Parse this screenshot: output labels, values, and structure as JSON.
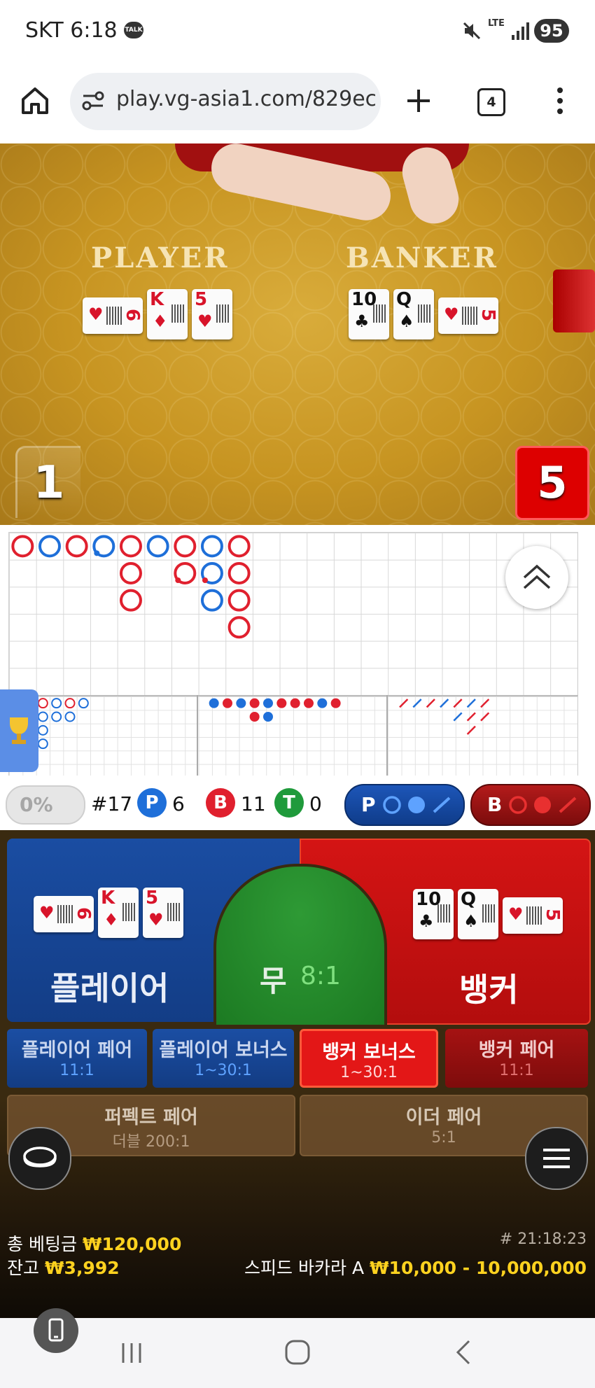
{
  "status_bar": {
    "carrier_time": "SKT 6:18",
    "talk_badge": "TALK",
    "network": "LTE",
    "battery": "95"
  },
  "browser": {
    "url": "play.vg-asia1.com/829ec",
    "tab_count": "4"
  },
  "video": {
    "player_label": "PLAYER",
    "banker_label": "BANKER",
    "player_cards": [
      {
        "rank": "6",
        "suit": "♥",
        "color": "red",
        "side": true
      },
      {
        "rank": "K",
        "suit": "♦",
        "color": "red"
      },
      {
        "rank": "5",
        "suit": "♥",
        "color": "red"
      }
    ],
    "banker_cards": [
      {
        "rank": "10",
        "suit": "♣",
        "color": "black"
      },
      {
        "rank": "Q",
        "suit": "♠",
        "color": "black"
      },
      {
        "rank": "5",
        "suit": "♥",
        "color": "red",
        "side": true
      }
    ],
    "player_score": "1",
    "banker_score": "5"
  },
  "colors": {
    "player": "#1e6fd9",
    "banker": "#e0202e",
    "tie": "#1f9a3b"
  },
  "roadmap": {
    "big_road": [
      [
        "B"
      ],
      [
        "P"
      ],
      [
        "B"
      ],
      [
        "P"
      ],
      [
        "B",
        "B",
        "B"
      ],
      [
        "P"
      ],
      [
        "B",
        "B"
      ],
      [
        "P",
        "P",
        "P"
      ],
      [
        "B",
        "B",
        "B",
        "B"
      ]
    ],
    "big_road_notes": "column stacks of results as shown"
  },
  "stats": {
    "percent": "0%",
    "round": "#17",
    "player_count": "6",
    "banker_count": "11",
    "tie_count": "0",
    "p_letter": "P",
    "b_letter": "B",
    "t_letter": "T"
  },
  "ask": {
    "player_label": "P",
    "banker_label": "B"
  },
  "bets": {
    "player": {
      "label": "플레이어"
    },
    "tie": {
      "label": "무",
      "odds": "8:1"
    },
    "banker": {
      "label": "뱅커"
    },
    "side_bets": [
      {
        "label": "플레이어 페어",
        "odds": "11:1"
      },
      {
        "label": "플레이어 보너스",
        "odds": "1~30:1"
      },
      {
        "label": "뱅커 보너스",
        "odds": "1~30:1"
      },
      {
        "label": "뱅커 페어",
        "odds": "11:1"
      }
    ],
    "perfect_pair": {
      "label": "퍼펙트 페어",
      "odds": "더블 200:1"
    },
    "either_pair": {
      "label": "이더 페어",
      "odds": "5:1"
    }
  },
  "footer": {
    "total_bet_label": "총 베팅금",
    "total_bet_value": "₩120,000",
    "balance_label": "잔고",
    "balance_value": "₩3,992",
    "round_id": "# 21:18:23",
    "table_name": "스피드 바카라 A",
    "limits": "₩10,000 - 10,000,000"
  }
}
